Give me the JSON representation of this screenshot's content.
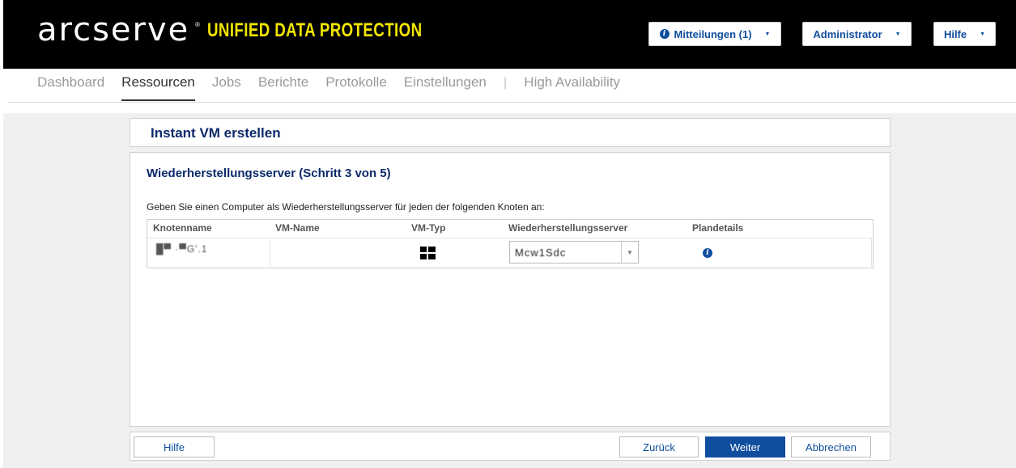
{
  "header": {
    "brand": "arcserve",
    "brand_mark": "®",
    "product": "UNIFIED DATA PROTECTION",
    "notifications_label": "Mitteilungen (1)",
    "admin_label": "Administrator",
    "help_label": "Hilfe",
    "caret": "▼"
  },
  "nav": {
    "items": [
      "Dashboard",
      "Ressourcen",
      "Jobs",
      "Berichte",
      "Protokolle",
      "Einstellungen",
      "|",
      "High Availability"
    ]
  },
  "wizard": {
    "title": "Instant VM erstellen",
    "step_title": "Wiederherstellungsserver (Schritt 3 von 5)",
    "description": "Geben Sie einen Computer als Wiederherstellungsserver für jeden der folgenden Knoten an:",
    "table": {
      "headers": [
        "Knotenname",
        "VM-Name",
        "VM-Typ",
        "Wiederherstellungsserver",
        "Plandetails"
      ],
      "rows": [
        {
          "node": "█▀ ·▀G'.1",
          "vm_name": "",
          "vm_type_icon": "windows-icon",
          "server": "Mcw1Sdc",
          "plan_icon": "info-icon"
        }
      ]
    },
    "footer": {
      "help": "Hilfe",
      "back": "Zurück",
      "next": "Weiter",
      "cancel": "Abbrechen"
    }
  },
  "colors": {
    "header_bg": "#000000",
    "product_yellow": "#f2e600",
    "accent_blue": "#0f4d9e",
    "title_navy": "#0c2a6b"
  }
}
